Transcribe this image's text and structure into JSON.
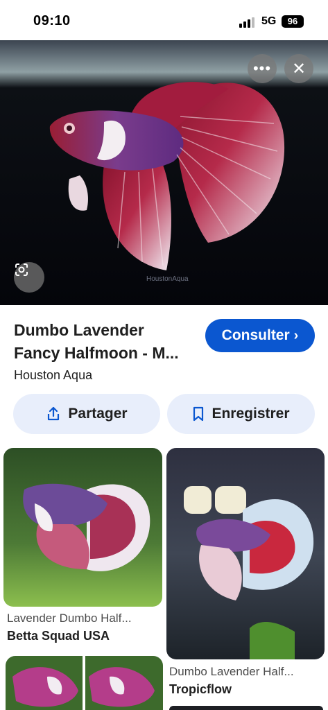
{
  "status_bar": {
    "time": "09:10",
    "network": "5G",
    "battery": "96"
  },
  "hero": {
    "watermark": "HoustonAqua",
    "more_icon": "more-horizontal-icon",
    "close_icon": "close-icon",
    "lens_icon": "google-lens-icon"
  },
  "result": {
    "title_line1": "Dumbo Lavender",
    "title_line2": "Fancy Halfmoon - M...",
    "source": "Houston Aqua",
    "visit_label": "Consulter",
    "share_label": "Partager",
    "save_label": "Enregistrer"
  },
  "related": [
    {
      "title": "Lavender Dumbo Half...",
      "source": "Betta Squad USA"
    },
    {
      "title": "Dumbo Lavender Half...",
      "source": "Tropicflow"
    }
  ],
  "colors": {
    "accent": "#0b57d0",
    "pill_bg": "#e8eefb"
  }
}
